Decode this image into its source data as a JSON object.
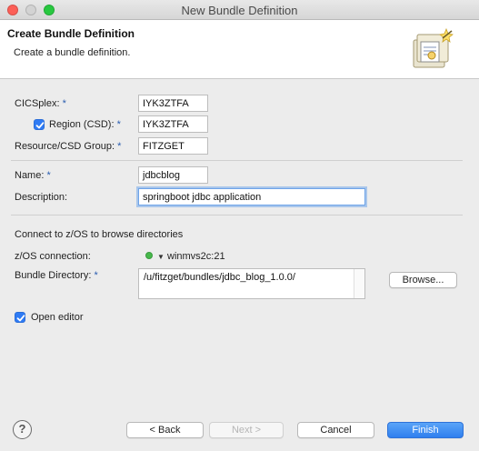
{
  "window": {
    "title": "New Bundle Definition"
  },
  "banner": {
    "title": "Create Bundle Definition",
    "description": "Create a bundle definition."
  },
  "form": {
    "cicsplex": {
      "label": "CICSplex:",
      "required": "*",
      "value": "IYK3ZTFA"
    },
    "region": {
      "label": "Region (CSD):",
      "required": "*",
      "value": "IYK3ZTFA",
      "checked": true
    },
    "resource_group": {
      "label": "Resource/CSD Group:",
      "required": "*",
      "value": "FITZGET"
    },
    "name": {
      "label": "Name:",
      "required": "*",
      "value": "jdbcblog"
    },
    "description": {
      "label": "Description:",
      "value": "springboot jdbc application"
    },
    "connect_heading": "Connect to z/OS to browse directories",
    "zos_connection": {
      "label": "z/OS connection:",
      "value": "winmvs2c:21",
      "status_color": "#47b84b"
    },
    "bundle_directory": {
      "label": "Bundle Directory:",
      "required": "*",
      "value": "/u/fitzget/bundles/jdbc_blog_1.0.0/"
    },
    "browse_label": "Browse...",
    "open_editor": {
      "label": "Open editor",
      "checked": true
    }
  },
  "footer": {
    "help_icon": "?",
    "back_label": "< Back",
    "next_label": "Next >",
    "cancel_label": "Cancel",
    "finish_label": "Finish"
  },
  "colors": {
    "accent": "#2f7bf4",
    "required_marker": "#2a5db0"
  }
}
